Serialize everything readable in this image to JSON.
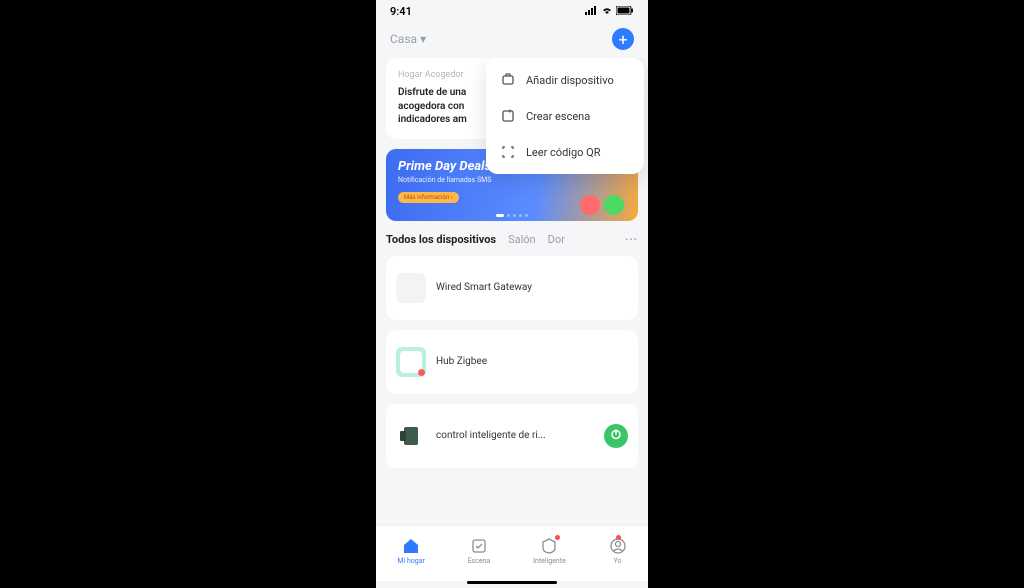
{
  "status": {
    "time": "9:41"
  },
  "header": {
    "home_label": "Casa"
  },
  "welcome": {
    "subtitle": "Hogar Acogedor",
    "text": "Disfrute de una acogedora con indicadores am"
  },
  "banner": {
    "title": "Prime Day Deals",
    "subtitle": "Notificación de llamadas SMS",
    "button": "Más información ›"
  },
  "tabs": {
    "all": "Todos los dispositivos",
    "room1": "Salón",
    "room2": "Dor"
  },
  "devices": [
    {
      "name": "Wired Smart Gateway"
    },
    {
      "name": "Hub Zigbee"
    },
    {
      "name": "control inteligente de ri..."
    }
  ],
  "dropdown": {
    "add": "Añadir dispositivo",
    "scene": "Crear escena",
    "qr": "Leer código QR"
  },
  "nav": {
    "home": "Mi hogar",
    "scene": "Escena",
    "smart": "Inteligente",
    "me": "Yo"
  }
}
